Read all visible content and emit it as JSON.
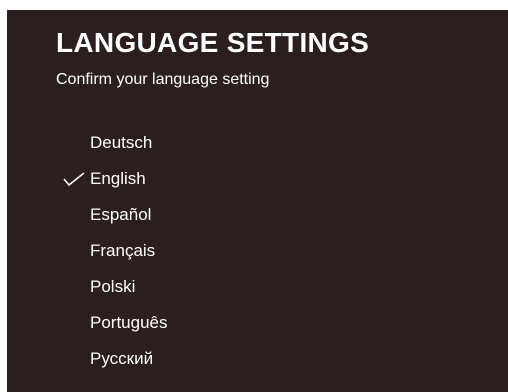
{
  "header": {
    "title": "LANGUAGE SETTINGS",
    "subtitle": "Confirm your language setting"
  },
  "languages": [
    {
      "label": "Deutsch",
      "selected": false
    },
    {
      "label": "English",
      "selected": true
    },
    {
      "label": "Español",
      "selected": false
    },
    {
      "label": "Français",
      "selected": false
    },
    {
      "label": "Polski",
      "selected": false
    },
    {
      "label": "Português",
      "selected": false
    },
    {
      "label": "Русский",
      "selected": false
    }
  ],
  "icons": {
    "selected_marker": "check-icon"
  },
  "colors": {
    "background": "#2a1f1e",
    "text": "#ffffff"
  }
}
